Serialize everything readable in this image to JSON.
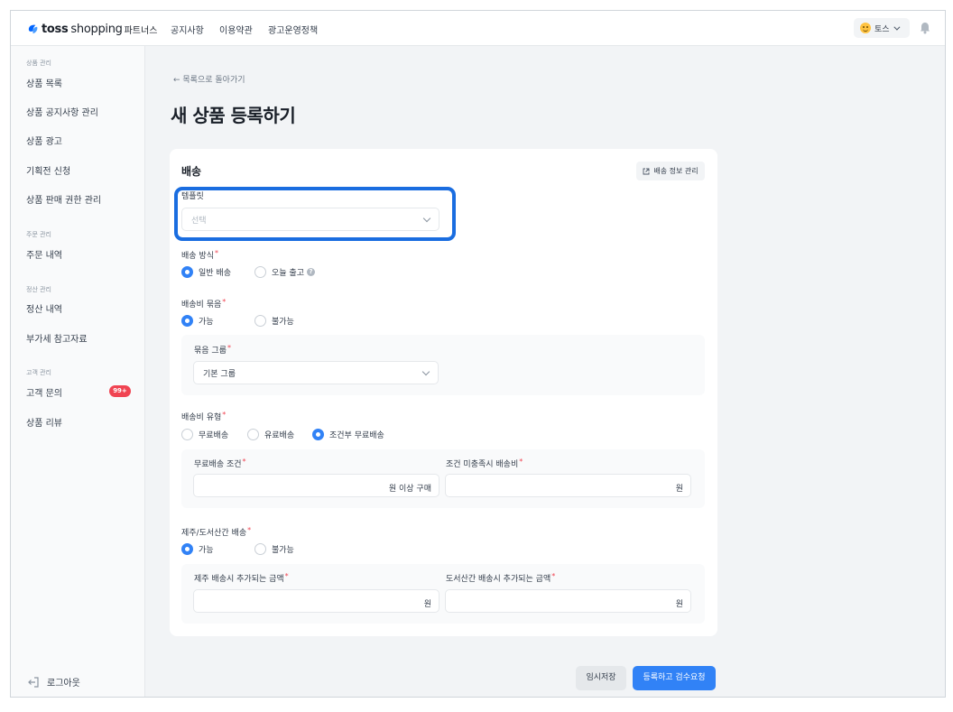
{
  "header": {
    "logo_brand": "toss",
    "logo_shop": "shopping",
    "logo_partner": "파트너스",
    "nav": [
      "공지사항",
      "이용약관",
      "광고운영정책"
    ],
    "user_name": "토스"
  },
  "sidebar": {
    "groups": [
      {
        "title": "상품 관리",
        "items": [
          "상품 목록",
          "상품 공지사항 관리",
          "상품 광고",
          "기획전 신청",
          "상품 판매 권한 관리"
        ]
      },
      {
        "title": "주문 관리",
        "items": [
          "주문 내역"
        ]
      },
      {
        "title": "정산 관리",
        "items": [
          "정산 내역",
          "부가세 참고자료"
        ]
      },
      {
        "title": "고객 관리",
        "items": [
          "고객 문의",
          "상품 리뷰"
        ]
      }
    ],
    "inquiry_badge": "99+",
    "logout_label": "로그아웃"
  },
  "main": {
    "back_link": "← 목록으로 돌아가기",
    "page_title": "새 상품 등록하기"
  },
  "delivery": {
    "section_title": "배송",
    "manage_button": "배송 정보 관리",
    "template_label": "템플릿",
    "template_placeholder": "선택",
    "method_label": "배송 방식",
    "method_options": [
      "일반 배송",
      "오늘 출고"
    ],
    "method_selected": "일반 배송",
    "bundle_label": "배송비 묶음",
    "bundle_options": [
      "가능",
      "불가능"
    ],
    "bundle_selected": "가능",
    "bundle_group_label": "묶음 그룹",
    "bundle_group_value": "기본 그룹",
    "fee_type_label": "배송비 유형",
    "fee_type_options": [
      "무료배송",
      "유료배송",
      "조건부 무료배송"
    ],
    "fee_type_selected": "조건부 무료배송",
    "free_condition_label": "무료배송 조건",
    "free_condition_suffix": "원 이상 구매",
    "unmet_fee_label": "조건 미충족시 배송비",
    "unmet_fee_suffix": "원",
    "island_label": "제주/도서산간 배송",
    "island_options": [
      "가능",
      "불가능"
    ],
    "island_selected": "가능",
    "jeju_fee_label": "제주 배송시 추가되는 금액",
    "jeju_fee_suffix": "원",
    "remote_fee_label": "도서산간 배송시 추가되는 금액",
    "remote_fee_suffix": "원"
  },
  "footer": {
    "save_draft": "임시저장",
    "submit": "등록하고 검수요청"
  },
  "colors": {
    "accent": "#3182f6",
    "highlight": "#1a6de0",
    "badge": "#f04452"
  }
}
